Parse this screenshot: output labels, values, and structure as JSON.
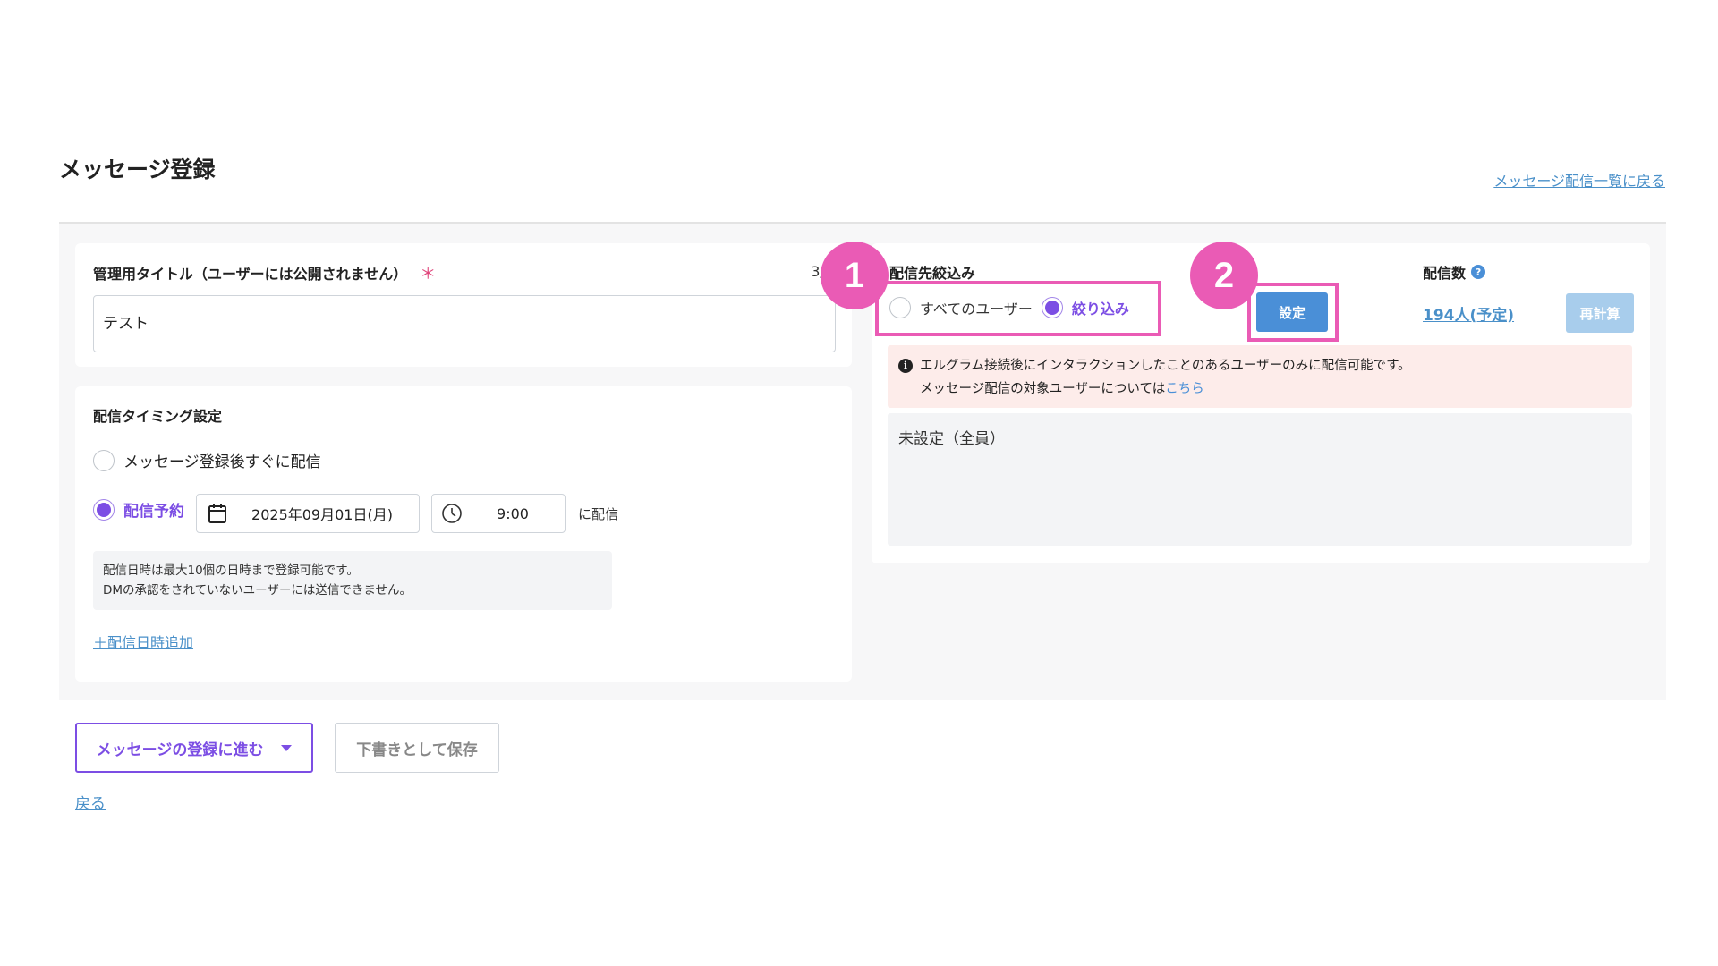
{
  "header": {
    "title": "メッセージ登録",
    "back_to_list": "メッセージ配信一覧に戻る"
  },
  "title_card": {
    "label": "管理用タイトル（ユーザーには公開されません）",
    "required_mark": "＊",
    "char_count": "3/2",
    "value": "テスト"
  },
  "timing": {
    "label": "配信タイミング設定",
    "option_immediate": "メッセージ登録後すぐに配信",
    "option_scheduled": "配信予約",
    "selected": "scheduled",
    "date": "2025年09月01日(月)",
    "time": "9:00",
    "suffix": "に配信",
    "note_line1": "配信日時は最大10個の日時まで登録可能です。",
    "note_line2": "DMの承認をされていないユーザーには送信できません。",
    "add_link": "＋配信日時追加",
    "icons": [
      "calendar-icon",
      "clock-icon"
    ]
  },
  "target": {
    "label": "配信先絞込み",
    "option_all": "すべてのユーザー",
    "option_filter": "絞り込み",
    "selected": "filter",
    "settings_button": "設定",
    "count_label": "配信数",
    "count_value": "194人(予定)",
    "recalc_button": "再計算",
    "info_line1": "エルグラム接続後にインタラクションしたことのあるユーザーのみに配信可能です。",
    "info_line2": "メッセージ配信の対象ユーザーについては",
    "info_link": "こちら",
    "unset_text": "未設定（全員）"
  },
  "annotations": {
    "badge1": "1",
    "badge2": "2",
    "highlight_color": "#ea5bb5"
  },
  "footer": {
    "submit_button": "メッセージの登録に進む",
    "draft_button": "下書きとして保存",
    "back_link": "戻る"
  },
  "colors": {
    "accent_purple": "#7c4ee4",
    "primary_blue": "#4a8fd7",
    "link_blue": "#4a90c9",
    "disabled_blue": "#a8cdec",
    "info_bg": "#fdecea"
  }
}
